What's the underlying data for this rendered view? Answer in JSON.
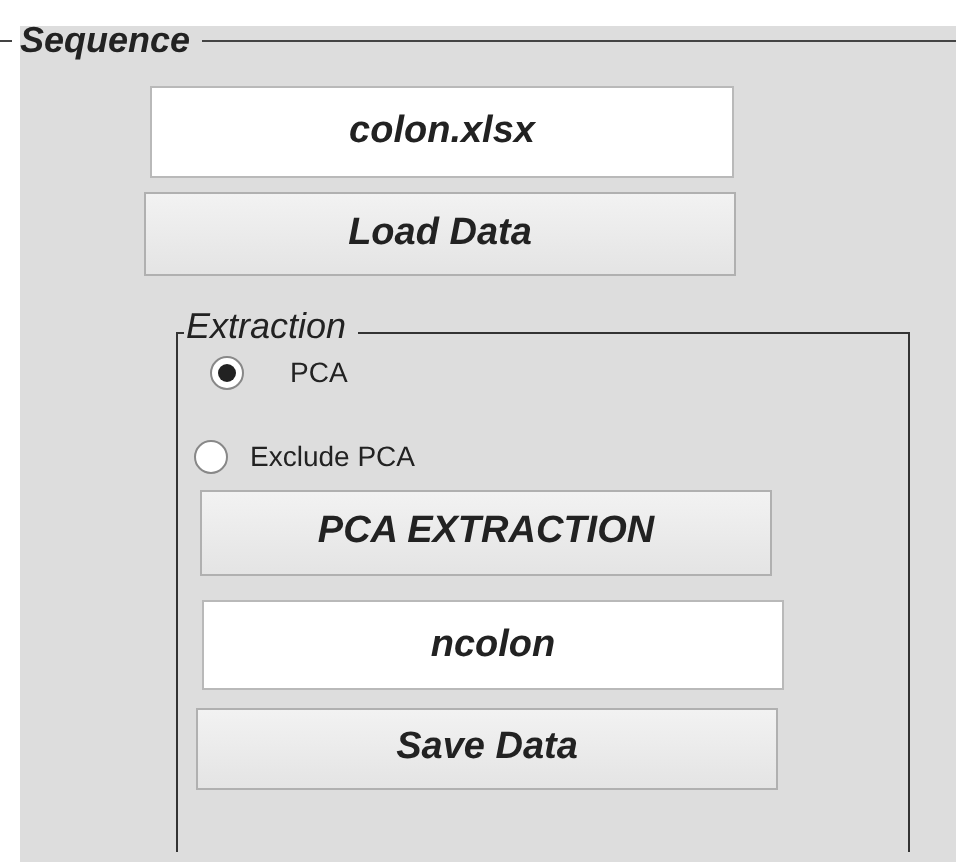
{
  "sequence": {
    "title": "Sequence",
    "file_field": {
      "value": "colon.xlsx"
    },
    "load_button": {
      "label": "Load Data"
    },
    "extraction": {
      "title": "Extraction",
      "options": [
        {
          "label": "PCA",
          "selected": true
        },
        {
          "label": "Exclude PCA",
          "selected": false
        }
      ],
      "extract_button": {
        "label": "PCA EXTRACTION"
      },
      "name_field": {
        "value": "ncolon"
      },
      "save_button": {
        "label": "Save Data"
      }
    }
  }
}
